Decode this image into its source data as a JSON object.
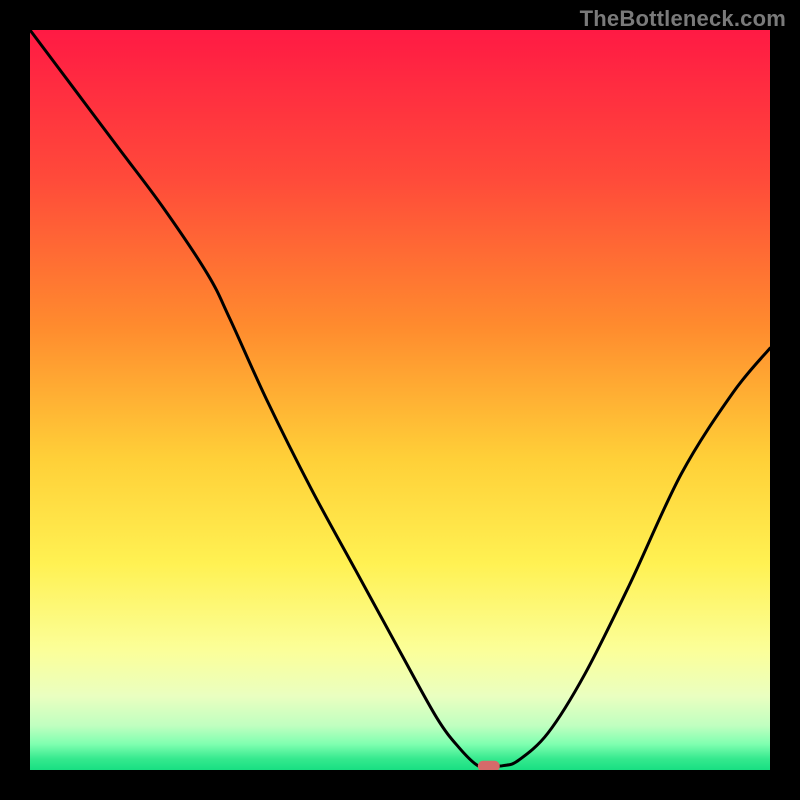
{
  "watermark": "TheBottleneck.com",
  "chart_data": {
    "type": "line",
    "title": "",
    "xlabel": "",
    "ylabel": "",
    "xlim": [
      0,
      100
    ],
    "ylim": [
      0,
      100
    ],
    "grid": false,
    "series": [
      {
        "name": "curve",
        "x": [
          0,
          6,
          12,
          18,
          24,
          27,
          32,
          38,
          44,
          50,
          55,
          58,
          60.5,
          62,
          64,
          66,
          70,
          75,
          81,
          88,
          95,
          100
        ],
        "y": [
          100,
          92,
          84,
          76,
          67,
          61,
          50,
          38,
          27,
          16,
          7,
          3,
          0.6,
          0.5,
          0.6,
          1.3,
          5,
          13,
          25,
          40,
          51,
          57
        ]
      }
    ],
    "marker": {
      "x": 62,
      "y": 0.5,
      "color": "#d66a6a"
    },
    "background": {
      "vertical_gradient_stops": [
        {
          "offset": 0.0,
          "color": "#ff1a44"
        },
        {
          "offset": 0.2,
          "color": "#ff4a3a"
        },
        {
          "offset": 0.4,
          "color": "#ff8b2e"
        },
        {
          "offset": 0.58,
          "color": "#ffd038"
        },
        {
          "offset": 0.72,
          "color": "#fff152"
        },
        {
          "offset": 0.84,
          "color": "#fbff9a"
        },
        {
          "offset": 0.9,
          "color": "#eaffc0"
        },
        {
          "offset": 0.94,
          "color": "#c0ffc0"
        },
        {
          "offset": 0.965,
          "color": "#7fffb0"
        },
        {
          "offset": 0.985,
          "color": "#35e98e"
        },
        {
          "offset": 1.0,
          "color": "#18df82"
        }
      ]
    }
  }
}
